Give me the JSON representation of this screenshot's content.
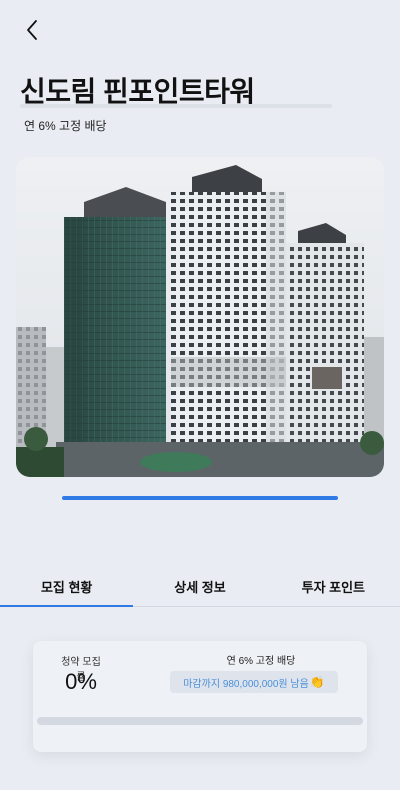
{
  "header": {
    "back_icon": "chevron-left-icon",
    "title": "신도림 핀포인트타워",
    "subtitle": "연 6% 고정 배당"
  },
  "carousel": {
    "total_slides": 1,
    "current_slide": 1
  },
  "tabs": [
    {
      "label": "모집 현황",
      "active": true
    },
    {
      "label": "상세 정보",
      "active": false
    },
    {
      "label": "투자 포인트",
      "active": false
    }
  ],
  "summary": {
    "rate_label": "청약 모집률",
    "rate_value": "0%",
    "rate_fraction": 0,
    "dividend_label": "연 6% 고정 배당",
    "deadline_text": "마감까지 980,000,000원 남음",
    "deadline_emoji": "👏"
  },
  "colors": {
    "accent": "#2f7ae5",
    "background": "#e9edf3",
    "pill_text": "#4a90d9"
  }
}
